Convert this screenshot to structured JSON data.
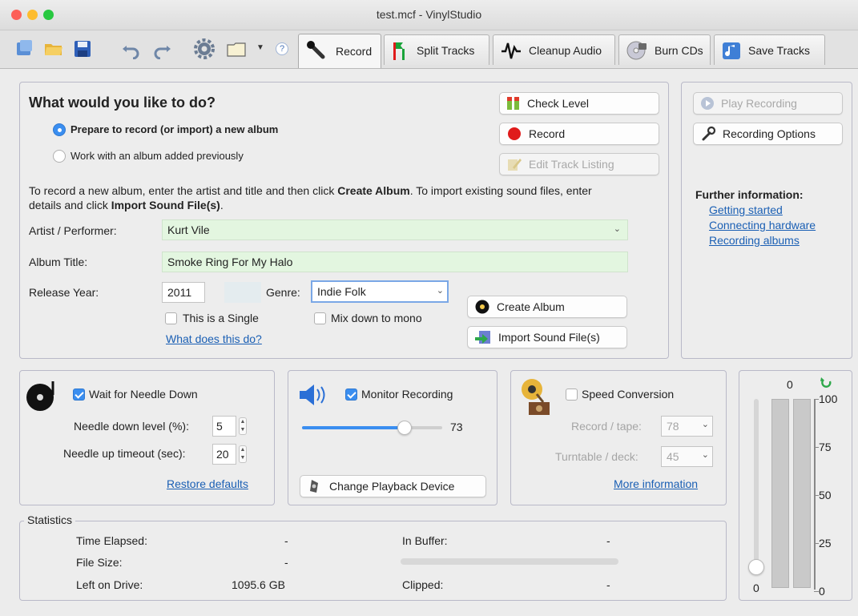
{
  "window": {
    "title": "test.mcf - VinylStudio"
  },
  "toolbar": {
    "help_label": "?",
    "tabs": [
      {
        "label": "Record"
      },
      {
        "label": "Split Tracks"
      },
      {
        "label": "Cleanup Audio"
      },
      {
        "label": "Burn CDs"
      },
      {
        "label": "Save Tracks"
      }
    ]
  },
  "main": {
    "heading": "What would you like to do?",
    "options": [
      {
        "label": "Prepare to record (or import) a new album",
        "selected": true
      },
      {
        "label": "Work with an album added previously",
        "selected": false
      }
    ],
    "instructions": {
      "p1": "To record a new album, enter the artist and title and then click ",
      "b1": "Create Album",
      "p2": ".  To import existing sound files, enter details and click ",
      "b2": "Import Sound File(s)",
      "p3": "."
    },
    "artist_label": "Artist / Performer:",
    "artist_value": "Kurt Vile",
    "album_label": "Album Title:",
    "album_value": "Smoke Ring For My Halo",
    "year_label": "Release Year:",
    "year_value": "2011",
    "genre_label": "Genre:",
    "genre_value": "Indie Folk",
    "single_label": "This is a Single",
    "mono_label": "Mix down to mono",
    "what_link": "What does this do?",
    "check_level": "Check Level",
    "record": "Record",
    "edit_tracks": "Edit Track Listing",
    "create_album": "Create Album",
    "import_files": "Import Sound File(s)"
  },
  "side": {
    "play_recording": "Play Recording",
    "recording_options": "Recording Options",
    "further_title": "Further information:",
    "links": [
      "Getting started",
      "Connecting hardware",
      "Recording albums"
    ]
  },
  "needle": {
    "wait_label": "Wait for Needle Down",
    "wait_checked": true,
    "down_label": "Needle down level (%):",
    "down_value": "5",
    "timeout_label": "Needle up timeout (sec):",
    "timeout_value": "20",
    "restore_link": "Restore defaults"
  },
  "monitor": {
    "label": "Monitor Recording",
    "checked": true,
    "volume": 73,
    "volume_text": "73",
    "change_device": "Change Playback Device"
  },
  "speed": {
    "label": "Speed Conversion",
    "record_label": "Record / tape:",
    "record_value": "78",
    "turntable_label": "Turntable / deck:",
    "turntable_value": "45",
    "more_link": "More information"
  },
  "stats": {
    "title": "Statistics",
    "time_label": "Time Elapsed:",
    "time_value": "-",
    "size_label": "File Size:",
    "size_value": "-",
    "left_label": "Left on Drive:",
    "left_value": "1095.6 GB",
    "buffer_label": "In Buffer:",
    "buffer_value": "-",
    "clipped_label": "Clipped:",
    "clipped_value": "-"
  },
  "meter": {
    "top_value": "0",
    "bottom_value": "0",
    "scale": [
      "100",
      "75",
      "50",
      "25",
      "0"
    ],
    "input_level": 0
  },
  "colors": {
    "accent": "#3a8ef0",
    "link": "#1a5fb4",
    "field_green": "#e3f6e0",
    "record_red": "#e01b1b"
  }
}
